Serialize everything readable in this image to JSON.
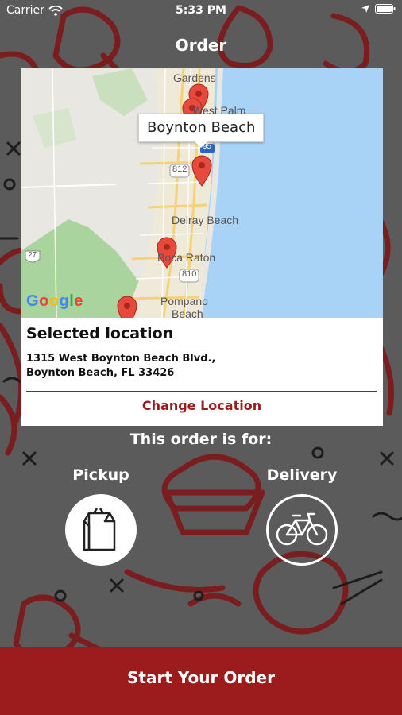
{
  "status_bar": {
    "carrier": "Carrier",
    "time": "5:33 PM",
    "icons": [
      "wifi-icon",
      "location-arrow-icon",
      "battery-icon"
    ]
  },
  "nav": {
    "title": "Order"
  },
  "map": {
    "tooltip": "Boynton Beach",
    "labels": {
      "gardens": "Gardens",
      "west_palm": "West Palm",
      "delray": "Delray Beach",
      "boca": "Boca Raton",
      "pompano": "Pompano",
      "pompano2": "Beach",
      "hwy_95": "95",
      "hwy_812": "812",
      "hwy_810": "810",
      "hwy_27": "27"
    },
    "logo_letters": [
      "G",
      "o",
      "o",
      "g",
      "l",
      "e"
    ],
    "colors": {
      "water": "#a8d3f6",
      "land": "#e9e7e2",
      "park": "#a9d49d",
      "pin": "#e74a3c"
    }
  },
  "location": {
    "heading": "Selected location",
    "address_line1": "1315 West Boynton Beach Blvd.,",
    "address_line2": "Boynton Beach, FL 33426",
    "change_label": "Change Location"
  },
  "order_type": {
    "prompt": "This order is for:",
    "pickup_label": "Pickup",
    "delivery_label": "Delivery",
    "selected": "Pickup"
  },
  "cta": {
    "start_label": "Start Your Order"
  },
  "colors": {
    "brand": "#9c1c1e",
    "background": "#5b5b5b",
    "pattern": "#7a1d1f"
  }
}
